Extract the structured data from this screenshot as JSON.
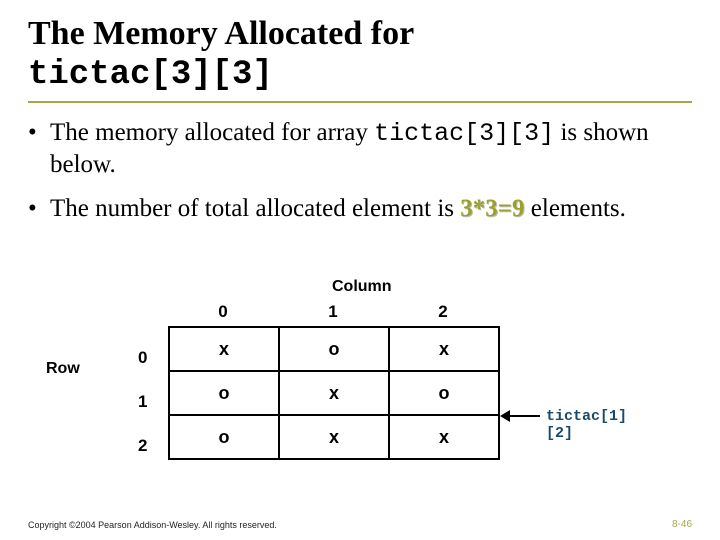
{
  "title": {
    "line1": "The Memory Allocated for",
    "code": "tictac[3][3]"
  },
  "bullets": {
    "b1_pre": "The memory allocated for array ",
    "b1_code": "tictac[3][3]",
    "b1_post": "is shown below.",
    "b2_pre": "The number of total allocated element is ",
    "b2_hi": "3*3=9",
    "b2_post": " elements."
  },
  "figure": {
    "column_label": "Column",
    "row_label": "Row",
    "col_heads": [
      "0",
      "1",
      "2"
    ],
    "row_heads": [
      "0",
      "1",
      "2"
    ],
    "cells": [
      [
        "x",
        "o",
        "x"
      ],
      [
        "o",
        "x",
        "o"
      ],
      [
        "o",
        "x",
        "x"
      ]
    ],
    "annotation": "tictac[1][2]"
  },
  "footer": "Copyright ©2004 Pearson Addison-Wesley. All rights reserved.",
  "pagenum": "8-46",
  "chart_data": {
    "type": "table",
    "title": "tictac[3][3] memory layout",
    "row_headers": [
      "0",
      "1",
      "2"
    ],
    "col_headers": [
      "0",
      "1",
      "2"
    ],
    "cells": [
      [
        "x",
        "o",
        "x"
      ],
      [
        "o",
        "x",
        "o"
      ],
      [
        "o",
        "x",
        "x"
      ]
    ],
    "highlight": {
      "row": 1,
      "col": 2,
      "label": "tictac[1][2]"
    }
  }
}
